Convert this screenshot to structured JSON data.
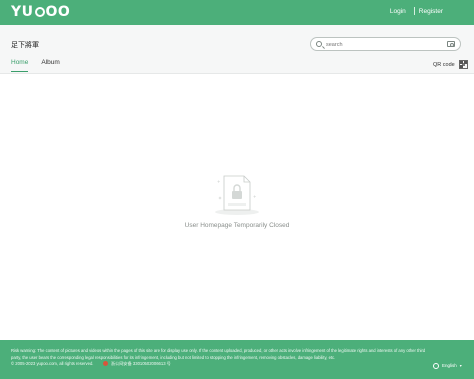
{
  "brand": {
    "logo": "YUPOO",
    "color": "#4caf7a"
  },
  "topnav": {
    "login": "Login",
    "register": "Register"
  },
  "header": {
    "store_name": "足下將軍",
    "search_placeholder": "search",
    "search_icon": "search-icon",
    "camera_icon": "camera-icon"
  },
  "tabs": [
    {
      "label": "Home",
      "active": true
    },
    {
      "label": "Album",
      "active": false
    }
  ],
  "qr": {
    "label": "QR code",
    "icon": "qr-code-icon"
  },
  "empty_state": {
    "icon": "locked-page-icon",
    "message": "User Homepage Temporarily Closed"
  },
  "footer": {
    "line1": "Risk warning: The content of pictures and videos within the pages of this site are for display use only. If the content uploaded, produced, or other acts involve infringement of the legitimate rights and interests of any other third",
    "line2": "party, the user bears the corresponding legal responsibilities for its infringement, including but not limited to stopping the infringement, removing obstacles, damage liability, etc.",
    "copyright": "© 2005-2023 yupoo.com, all rights reserved.",
    "beian": "浙公网安备 33010502006613 号",
    "language": "English"
  }
}
